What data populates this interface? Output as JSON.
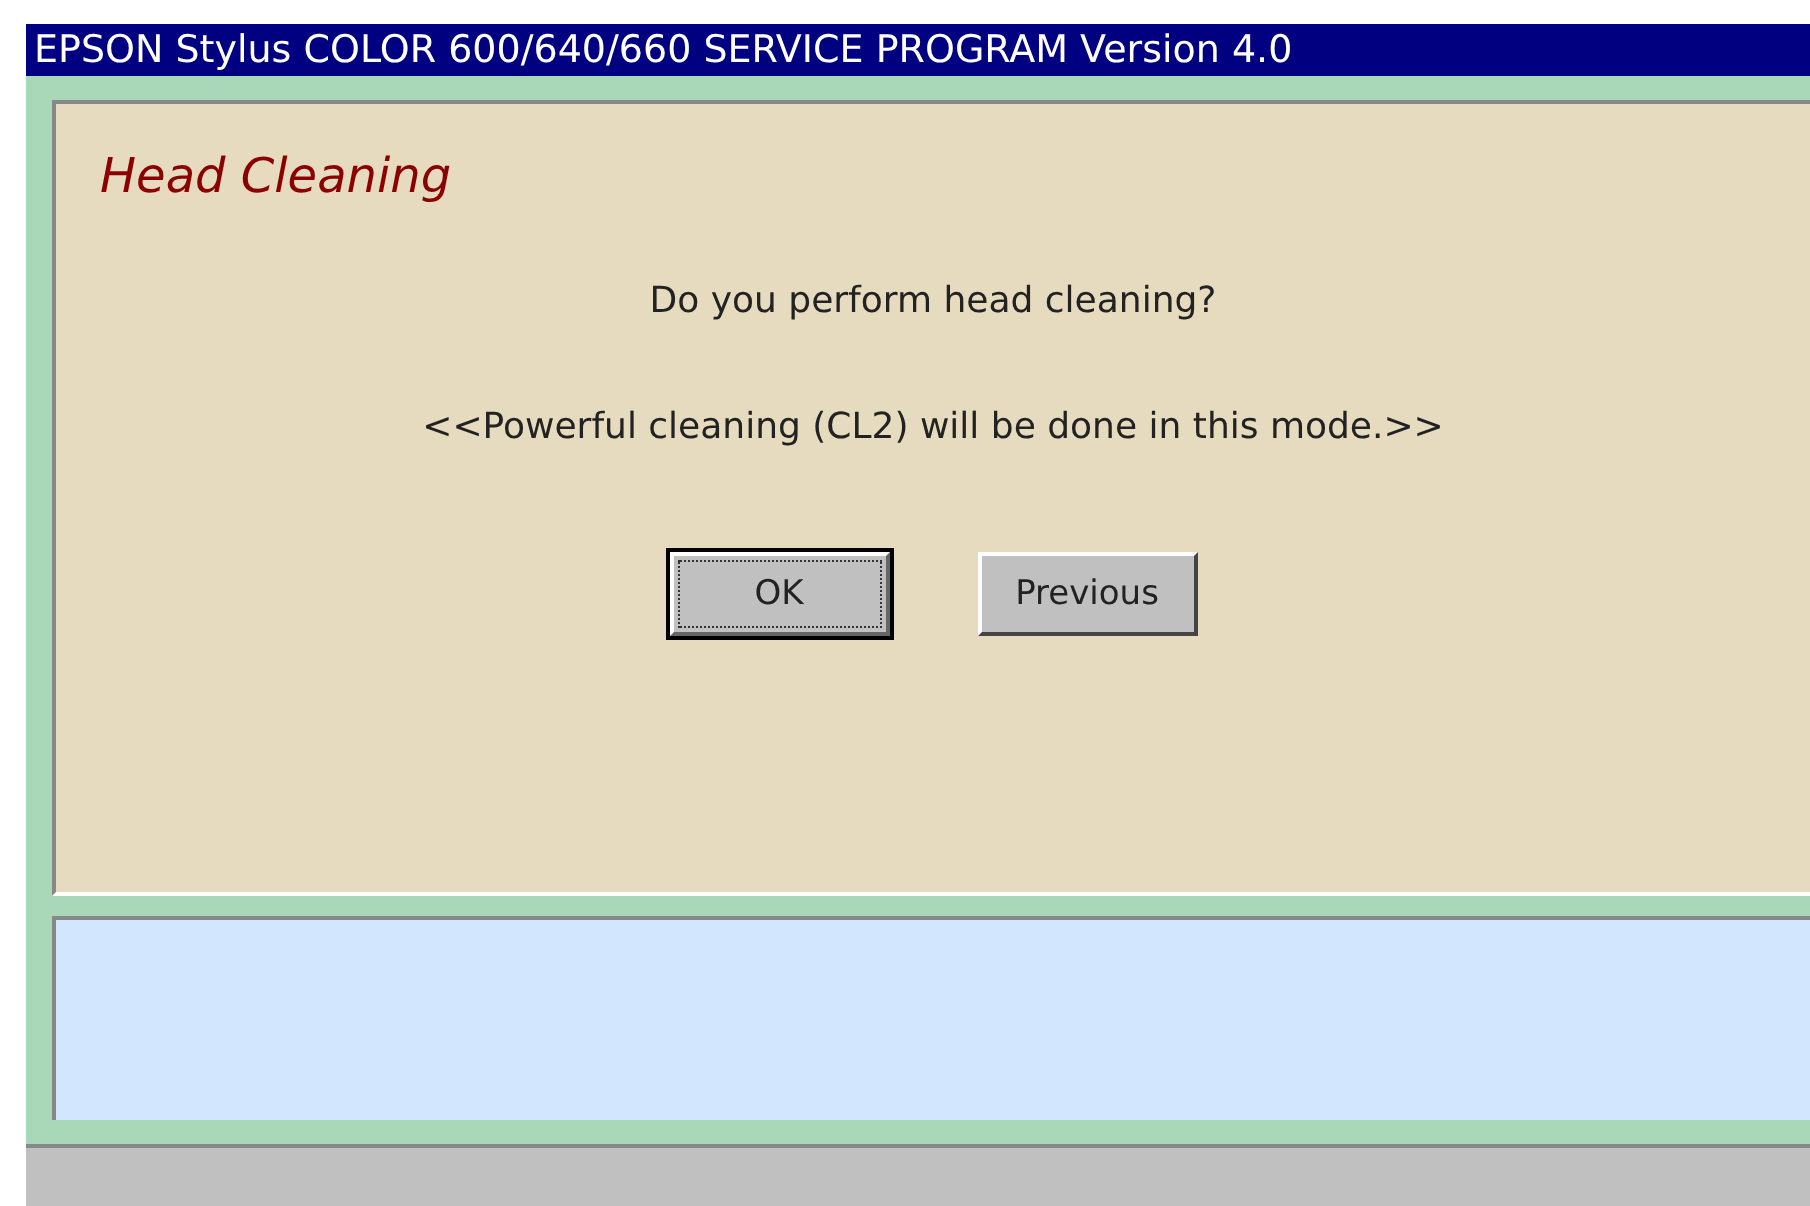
{
  "window": {
    "title": "EPSON Stylus COLOR 600/640/660 SERVICE PROGRAM  Version 4.0"
  },
  "panel": {
    "heading": "Head Cleaning",
    "question": "Do you perform head cleaning?",
    "note": "<<Powerful cleaning (CL2) will be done in this mode.>>"
  },
  "buttons": [
    {
      "label": "OK",
      "focused": true
    },
    {
      "label": "Previous",
      "focused": false
    }
  ]
}
